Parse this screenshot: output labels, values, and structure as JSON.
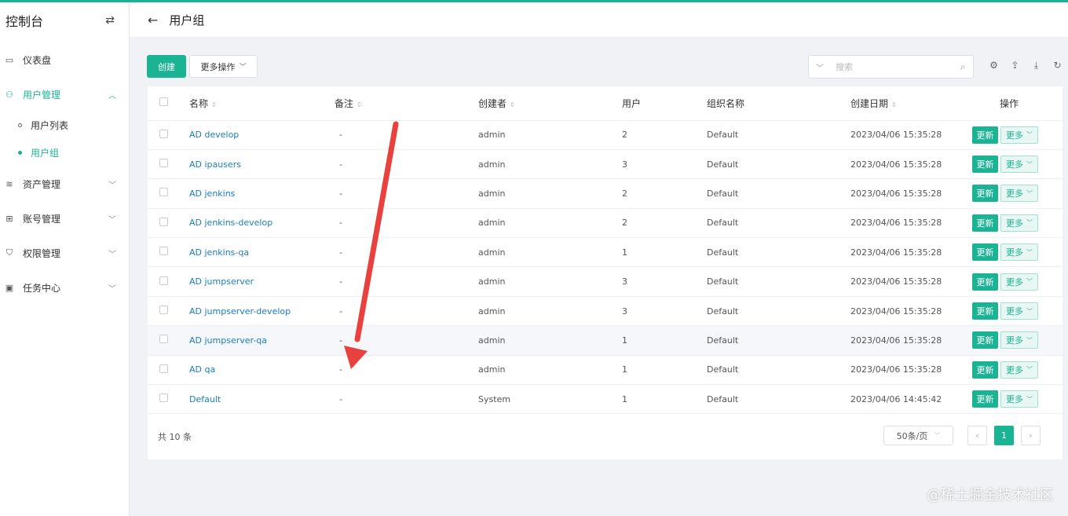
{
  "sidebar": {
    "title": "控制台",
    "items": [
      {
        "label": "仪表盘",
        "icon": "dashboard-icon",
        "glyph": "▭"
      },
      {
        "label": "用户管理",
        "icon": "users-icon",
        "glyph": "⚇",
        "expanded": true,
        "children": [
          {
            "label": "用户列表"
          },
          {
            "label": "用户组",
            "active": true
          }
        ]
      },
      {
        "label": "资产管理",
        "icon": "layers-icon",
        "glyph": "≋"
      },
      {
        "label": "账号管理",
        "icon": "account-icon",
        "glyph": "⊞"
      },
      {
        "label": "权限管理",
        "icon": "shield-icon",
        "glyph": "⛉"
      },
      {
        "label": "任务中心",
        "icon": "task-icon",
        "glyph": "▣"
      }
    ]
  },
  "header": {
    "title": "用户组"
  },
  "toolbar": {
    "create_label": "创建",
    "more_ops_label": "更多操作",
    "search_placeholder": "搜索"
  },
  "table": {
    "columns": [
      "名称",
      "备注",
      "创建者",
      "用户",
      "组织名称",
      "创建日期",
      "操作"
    ],
    "rows": [
      {
        "name": "AD develop",
        "comment": "-",
        "creator": "admin",
        "users": "2",
        "org": "Default",
        "date": "2023/04/06 15:35:28"
      },
      {
        "name": "AD ipausers",
        "comment": "-",
        "creator": "admin",
        "users": "3",
        "org": "Default",
        "date": "2023/04/06 15:35:28"
      },
      {
        "name": "AD jenkins",
        "comment": "-",
        "creator": "admin",
        "users": "2",
        "org": "Default",
        "date": "2023/04/06 15:35:28"
      },
      {
        "name": "AD jenkins-develop",
        "comment": "-",
        "creator": "admin",
        "users": "2",
        "org": "Default",
        "date": "2023/04/06 15:35:28"
      },
      {
        "name": "AD jenkins-qa",
        "comment": "-",
        "creator": "admin",
        "users": "1",
        "org": "Default",
        "date": "2023/04/06 15:35:28"
      },
      {
        "name": "AD jumpserver",
        "comment": "-",
        "creator": "admin",
        "users": "3",
        "org": "Default",
        "date": "2023/04/06 15:35:28"
      },
      {
        "name": "AD jumpserver-develop",
        "comment": "-",
        "creator": "admin",
        "users": "3",
        "org": "Default",
        "date": "2023/04/06 15:35:28"
      },
      {
        "name": "AD jumpserver-qa",
        "comment": "-",
        "creator": "admin",
        "users": "1",
        "org": "Default",
        "date": "2023/04/06 15:35:28"
      },
      {
        "name": "AD qa",
        "comment": "-",
        "creator": "admin",
        "users": "1",
        "org": "Default",
        "date": "2023/04/06 15:35:28"
      },
      {
        "name": "Default",
        "comment": "-",
        "creator": "System",
        "users": "1",
        "org": "Default",
        "date": "2023/04/06 14:45:42"
      }
    ],
    "update_label": "更新",
    "more_label": "更多"
  },
  "footer": {
    "total": "共 10 条",
    "page_size": "50条/页",
    "current_page": "1"
  },
  "watermark": "@稀土掘金技术社区",
  "colors": {
    "accent": "#1ab394",
    "link": "#1a7dbf",
    "annotation_arrow": "#e8413e"
  }
}
